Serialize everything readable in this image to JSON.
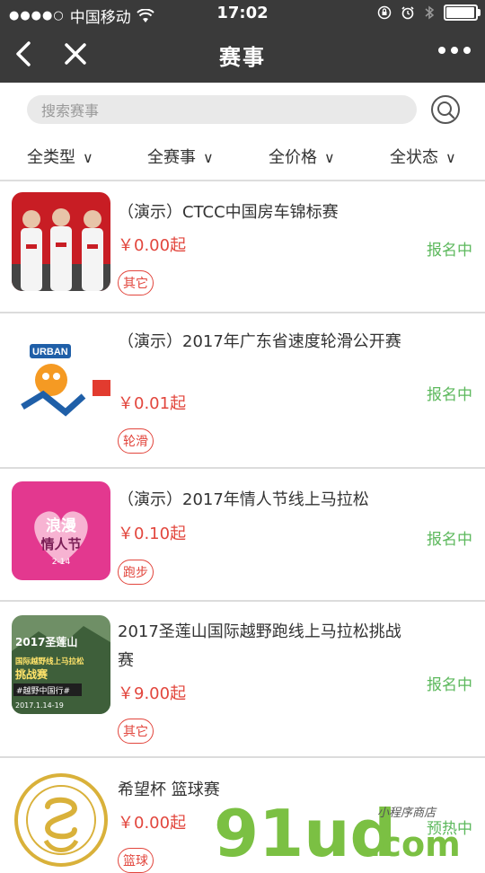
{
  "status_bar": {
    "signal_dots": "●●●●○",
    "carrier": "中国移动",
    "time": "17:02"
  },
  "nav": {
    "title": "赛事",
    "back_icon": "chevron-left-icon",
    "close_icon": "close-icon",
    "more_icon": "more-dots-icon"
  },
  "search": {
    "placeholder": "搜索赛事"
  },
  "filters": [
    {
      "label": "全类型",
      "chevron": "∨"
    },
    {
      "label": "全赛事",
      "chevron": "∨"
    },
    {
      "label": "全价格",
      "chevron": "∨"
    },
    {
      "label": "全状态",
      "chevron": "∨"
    }
  ],
  "events": [
    {
      "title": "（演示）CTCC中国房车锦标赛",
      "price": "￥0.00起",
      "tag": "其它",
      "status": "报名中"
    },
    {
      "title": "（演示）2017年广东省速度轮滑公开赛",
      "price": "￥0.01起",
      "tag": "轮滑",
      "status": "报名中"
    },
    {
      "title": "（演示）2017年情人节线上马拉松",
      "price": "￥0.10起",
      "tag": "跑步",
      "status": "报名中"
    },
    {
      "title": "2017圣莲山国际越野跑线上马拉松挑战赛",
      "price": "￥9.00起",
      "tag": "其它",
      "status": "报名中"
    },
    {
      "title": "希望杯 篮球赛",
      "price": "￥0.00起",
      "tag": "篮球",
      "status": "预热中"
    }
  ],
  "thumbs": {
    "t2_urban": "URBAN",
    "t3_line1": "浪漫",
    "t3_line2": "情人节",
    "t3_date": "2-14",
    "t4_line1": "2017圣莲山",
    "t4_line2": "国际越野线上马拉松",
    "t4_line3": "挑战赛",
    "t4_line4": "#越野中国行#",
    "t4_date": "2017.1.14-19"
  },
  "watermark": {
    "logo": "91ud",
    "sub": ".com",
    "tagline": "小程序商店"
  },
  "colors": {
    "nav_bg": "#3a3a3a",
    "price_red": "#e2463d",
    "status_green": "#5cb85c"
  }
}
